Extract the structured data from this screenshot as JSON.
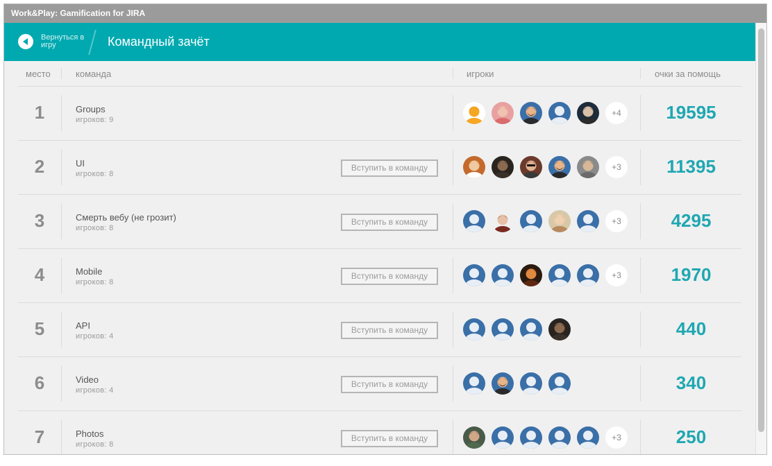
{
  "window": {
    "title": "Work&Play: Gamification for JIRA"
  },
  "header": {
    "back_label": "Вернуться в игру",
    "title": "Командный зачёт",
    "accent": "#00a9b0"
  },
  "columns": {
    "rank": "место",
    "team": "команда",
    "players": "игроки",
    "points": "очки за помощь"
  },
  "join_label": "Вступить в команду",
  "rows": [
    {
      "rank": "1",
      "name": "Groups",
      "count": "игроков: 9",
      "join": false,
      "avatars": [
        "cartoon-cat",
        "photo-pink",
        "bearded-man",
        "default",
        "photo-man"
      ],
      "more": "+4",
      "score": "19595"
    },
    {
      "rank": "2",
      "name": "UI",
      "count": "игроков: 8",
      "join": true,
      "avatars": [
        "photo-woman",
        "photo-dark",
        "photo-sunglasses",
        "bearded-man",
        "photo-man2"
      ],
      "more": "+3",
      "score": "11395"
    },
    {
      "rank": "3",
      "name": "Смерть вебу (не грозит)",
      "count": "игроков: 8",
      "join": true,
      "avatars": [
        "default",
        "photo-woman-dark",
        "default",
        "photo-blonde",
        "default"
      ],
      "more": "+3",
      "score": "4295"
    },
    {
      "rank": "4",
      "name": "Mobile",
      "count": "игроков: 8",
      "join": true,
      "avatars": [
        "default",
        "default",
        "photo-orange",
        "default",
        "default"
      ],
      "more": "+3",
      "score": "1970"
    },
    {
      "rank": "5",
      "name": "API",
      "count": "игроков: 4",
      "join": true,
      "avatars": [
        "default",
        "default",
        "default",
        "photo-dark"
      ],
      "more": "",
      "score": "440"
    },
    {
      "rank": "6",
      "name": "Video",
      "count": "игроков: 4",
      "join": true,
      "avatars": [
        "default",
        "bearded-man",
        "default",
        "default"
      ],
      "more": "",
      "score": "340"
    },
    {
      "rank": "7",
      "name": "Photos",
      "count": "игроков: 8",
      "join": true,
      "avatars": [
        "photo-man3",
        "default",
        "default",
        "default",
        "default"
      ],
      "more": "+3",
      "score": "250"
    }
  ]
}
